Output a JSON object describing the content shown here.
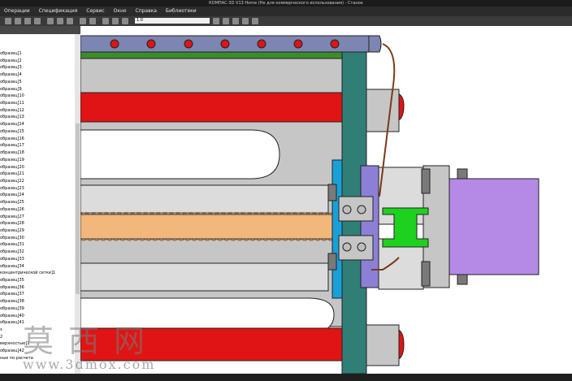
{
  "window": {
    "title": "КОМПАС-3D V13 Home (Не для коммерческого использования) - Станок"
  },
  "menu": [
    "Операции",
    "Спецификация",
    "Сервис",
    "Окно",
    "Справка",
    "Библиотеки"
  ],
  "toolbar": {
    "zoom_value": "1.0"
  },
  "tree": {
    "items": [
      "образец]1",
      "образец]2",
      "образец]3",
      "образец]4",
      "образец]5",
      "образец]9",
      "образец]10",
      "образец]11",
      "образец]12",
      "образец]13",
      "образец]14",
      "образец]15",
      "образец]16",
      "образец]17",
      "образец]18",
      "образец]19",
      "образец]20",
      "образец]21",
      "образец]22",
      "образец]23",
      "образец]24",
      "образец]25",
      "образец]26",
      "образец]27",
      "образец]28",
      "образец]29",
      "образец]30",
      "образец]31",
      "образец]32",
      "образец]33",
      "образец]34",
      "концентрической сетке]1",
      "образец]35",
      "образец]36",
      "образец]37",
      "образец]38",
      "образец]39",
      "образец]40",
      "образец]41",
      "з",
      "2",
      "верхностью]1",
      "образец]42",
      "ные по расчета"
    ]
  },
  "watermark": {
    "cn": "莫西网",
    "url": "www.3dmox.com"
  },
  "colors": {
    "red": "#e01414",
    "teal": "#2f7f77",
    "purple": "#b48ae6",
    "violet": "#8e7fd6",
    "orange": "#f2b77a",
    "green": "#1fd11f",
    "steel_blue": "#7d86b2",
    "blue": "#1aa0d8",
    "gray": "#c6c6c6"
  },
  "icons": [
    "new-file-icon",
    "open-icon",
    "save-icon",
    "print-icon",
    "cut-icon",
    "copy-icon",
    "paste-icon",
    "undo-icon",
    "redo-icon",
    "zoom-icon",
    "rotate-icon",
    "pan-icon",
    "rebuild-icon"
  ]
}
